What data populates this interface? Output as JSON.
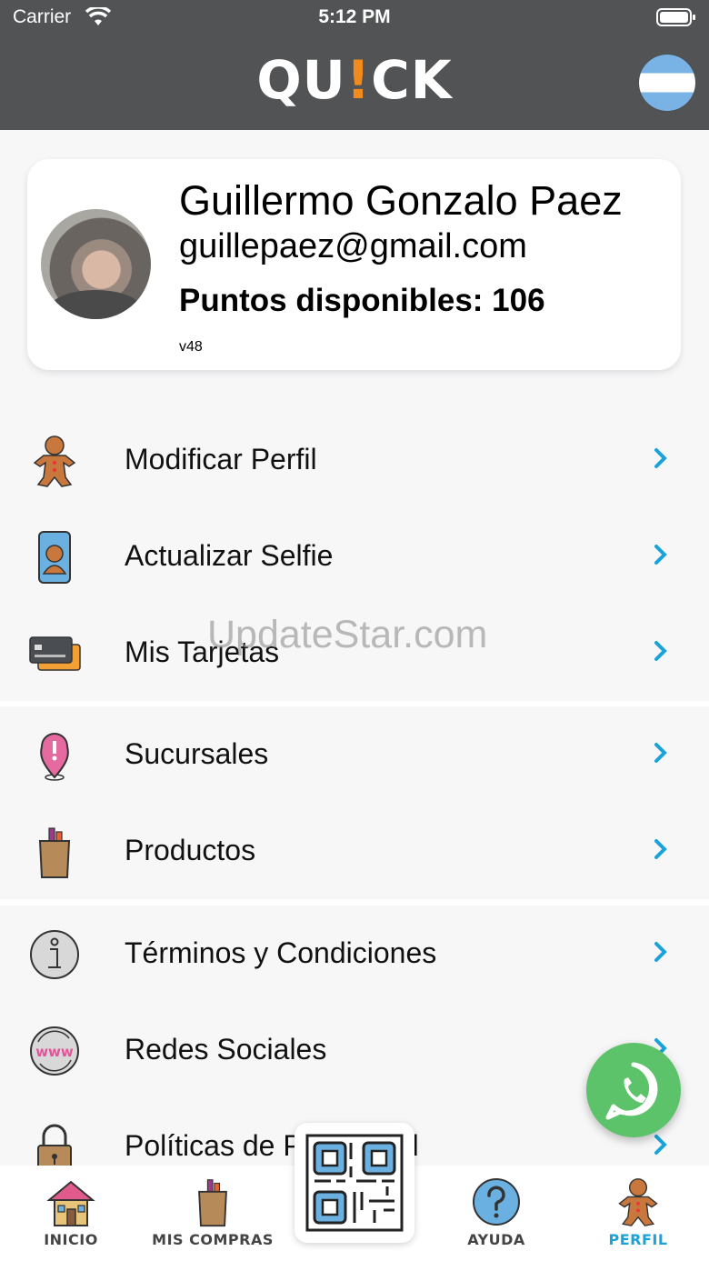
{
  "status_bar": {
    "carrier": "Carrier",
    "time": "5:12 PM"
  },
  "header": {
    "logo_left": "QU",
    "logo_bang": "!",
    "logo_right": "CK",
    "flag": "argentina-flag"
  },
  "profile": {
    "name": "Guillermo Gonzalo Paez",
    "email": "guillepaez@gmail.com",
    "points": "Puntos disponibles: 106",
    "version": "v48"
  },
  "menu_groups": [
    {
      "items": [
        {
          "label": "Modificar Perfil",
          "icon": "gingerbread-icon"
        },
        {
          "label": "Actualizar Selfie",
          "icon": "phone-selfie-icon"
        },
        {
          "label": "Mis Tarjetas",
          "icon": "credit-card-icon"
        }
      ]
    },
    {
      "items": [
        {
          "label": "Sucursales",
          "icon": "location-pin-icon"
        },
        {
          "label": "Productos",
          "icon": "grocery-bag-icon"
        }
      ]
    },
    {
      "items": [
        {
          "label": "Términos y Condiciones",
          "icon": "info-icon"
        },
        {
          "label": "Redes Sociales",
          "icon": "www-icon"
        },
        {
          "label": "Políticas de Privacidad",
          "icon": "padlock-icon"
        }
      ]
    }
  ],
  "watermark": "UpdateStar.com",
  "tabbar": {
    "tabs": [
      {
        "label": "INICIO",
        "icon": "house-icon"
      },
      {
        "label": "MIS COMPRAS",
        "icon": "grocery-bag-icon"
      },
      {
        "label": "AYUDA",
        "icon": "question-icon"
      },
      {
        "label": "PERFIL",
        "icon": "gingerbread-icon"
      }
    ],
    "active": "PERFIL",
    "active_color": "#1aa3d9"
  },
  "colors": {
    "header_bg": "#515355",
    "accent": "#1aa3d9",
    "logo_bang": "#f28b1e",
    "whatsapp": "#5cc36a"
  }
}
